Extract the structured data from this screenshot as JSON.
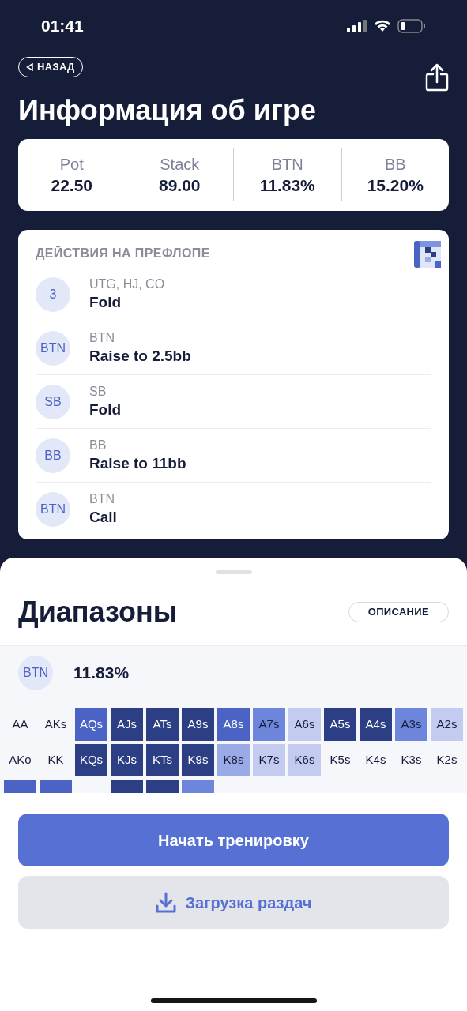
{
  "status_bar": {
    "time": "01:41"
  },
  "back_button": {
    "label": "НАЗАД"
  },
  "title": "Информация об игре",
  "stats": [
    {
      "label": "Pot",
      "value": "22.50"
    },
    {
      "label": "Stack",
      "value": "89.00"
    },
    {
      "label": "BTN",
      "value": "11.83%"
    },
    {
      "label": "BB",
      "value": "15.20%"
    }
  ],
  "actions": {
    "heading": "ДЕЙСТВИЯ НА ПРЕФЛОПЕ",
    "items": [
      {
        "badge": "3",
        "players": "UTG, HJ, CO",
        "action": "Fold"
      },
      {
        "badge": "BTN",
        "players": "BTN",
        "action": "Raise to 2.5bb"
      },
      {
        "badge": "SB",
        "players": "SB",
        "action": "Fold"
      },
      {
        "badge": "BB",
        "players": "BB",
        "action": "Raise to 11bb"
      },
      {
        "badge": "BTN",
        "players": "BTN",
        "action": "Call"
      }
    ]
  },
  "ranges": {
    "title": "Диапазоны",
    "description_button": "ОПИСАНИЕ",
    "player": {
      "badge": "BTN",
      "percent": "11.83%"
    },
    "grid": [
      [
        {
          "hand": "AA"
        },
        {
          "hand": "AKs"
        },
        {
          "hand": "AQs",
          "color": "#4a63c4"
        },
        {
          "hand": "AJs",
          "color": "#2c3f85"
        },
        {
          "hand": "ATs",
          "color": "#2c3f85"
        },
        {
          "hand": "A9s",
          "color": "#2c3f85"
        },
        {
          "hand": "A8s",
          "color": "#4a63c4"
        },
        {
          "hand": "A7s",
          "color": "#6d86dc"
        },
        {
          "hand": "A6s",
          "color": "#c3cbf0"
        },
        {
          "hand": "A5s",
          "color": "#2c3f85"
        },
        {
          "hand": "A4s",
          "color": "#2c3f85"
        },
        {
          "hand": "A3s",
          "color": "#6d86dc"
        },
        {
          "hand": "A2s",
          "color": "#c3cbf0"
        }
      ],
      [
        {
          "hand": "AKo"
        },
        {
          "hand": "KK"
        },
        {
          "hand": "KQs",
          "color": "#2c3f85"
        },
        {
          "hand": "KJs",
          "color": "#2c3f85"
        },
        {
          "hand": "KTs",
          "color": "#2c3f85"
        },
        {
          "hand": "K9s",
          "color": "#2c3f85"
        },
        {
          "hand": "K8s",
          "color": "#9aaae6"
        },
        {
          "hand": "K7s",
          "color": "#c3cbf0"
        },
        {
          "hand": "K6s",
          "color": "#c3cbf0"
        },
        {
          "hand": "K5s"
        },
        {
          "hand": "K4s"
        },
        {
          "hand": "K3s"
        },
        {
          "hand": "K2s"
        }
      ],
      [
        {
          "kind": "cut",
          "color": "#4a63c4"
        },
        {
          "kind": "cut",
          "color": "#4a63c4"
        },
        {
          "kind": "cut"
        },
        {
          "kind": "cut",
          "color": "#2c3f85"
        },
        {
          "kind": "cut",
          "color": "#2c3f85"
        },
        {
          "kind": "cut",
          "color": "#6d86dc"
        },
        {
          "kind": "cut"
        },
        {
          "kind": "cut"
        },
        {
          "kind": "cut"
        },
        {
          "kind": "cut"
        },
        {
          "kind": "cut"
        },
        {
          "kind": "cut"
        },
        {
          "kind": "cut"
        }
      ]
    ]
  },
  "primary_button": "Начать тренировку",
  "secondary_button": "Загрузка раздач"
}
